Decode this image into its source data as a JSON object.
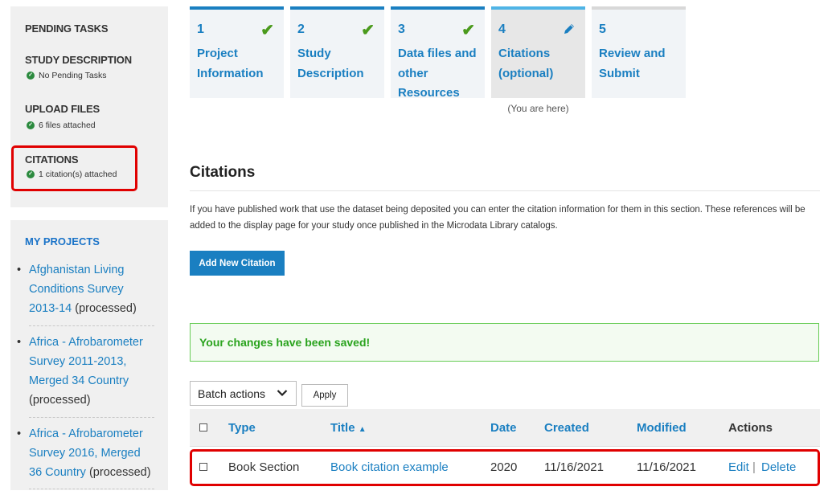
{
  "sidebar": {
    "pending_title": "PENDING TASKS",
    "tasks": [
      {
        "title": "STUDY DESCRIPTION",
        "status": "No Pending Tasks"
      },
      {
        "title": "UPLOAD FILES",
        "status": "6 files attached"
      },
      {
        "title": "CITATIONS",
        "status": "1 citation(s) attached"
      }
    ],
    "projects_title": "MY PROJECTS",
    "projects": [
      {
        "name_lines": [
          "Afghanistan Living",
          "Conditions Survey",
          "2013-14"
        ],
        "status": "(processed)"
      },
      {
        "name_lines": [
          "Africa - Afrobarometer",
          "Survey 2011-2013,",
          "Merged 34 Country"
        ],
        "status": "(processed)"
      },
      {
        "name_lines": [
          "Africa - Afrobarometer",
          "Survey 2016, Merged",
          "36 Country"
        ],
        "status": "(processed)"
      }
    ]
  },
  "steps": [
    {
      "num": "1",
      "label": "Project Information",
      "state": "done"
    },
    {
      "num": "2",
      "label": "Study Description",
      "state": "done"
    },
    {
      "num": "3",
      "label": "Data files and other Resources",
      "state": "done"
    },
    {
      "num": "4",
      "label": "Citations (optional)",
      "state": "current"
    },
    {
      "num": "5",
      "label": "Review and Submit",
      "state": "future"
    }
  ],
  "you_are_here": "(You are here)",
  "main": {
    "heading": "Citations",
    "description": "If you have published work that use the dataset being deposited you can enter the citation information for them in this section. These references will be added to the display page for your study once published in the Microdata Library catalogs.",
    "add_button": "Add New Citation",
    "saved_message": "Your changes have been saved!",
    "batch_label": "Batch actions",
    "apply_label": "Apply"
  },
  "table": {
    "headers": {
      "type": "Type",
      "title": "Title",
      "date": "Date",
      "created": "Created",
      "modified": "Modified",
      "actions": "Actions"
    },
    "sort_indicator": "▲",
    "rows": [
      {
        "type": "Book Section",
        "title": "Book citation example",
        "date": "2020",
        "created": "11/16/2021",
        "modified": "11/16/2021",
        "edit": "Edit",
        "sep": "|",
        "delete": "Delete"
      }
    ]
  },
  "colors": {
    "accent": "#1a7fc1",
    "success": "#2aa31e",
    "highlight": "#e00000"
  }
}
